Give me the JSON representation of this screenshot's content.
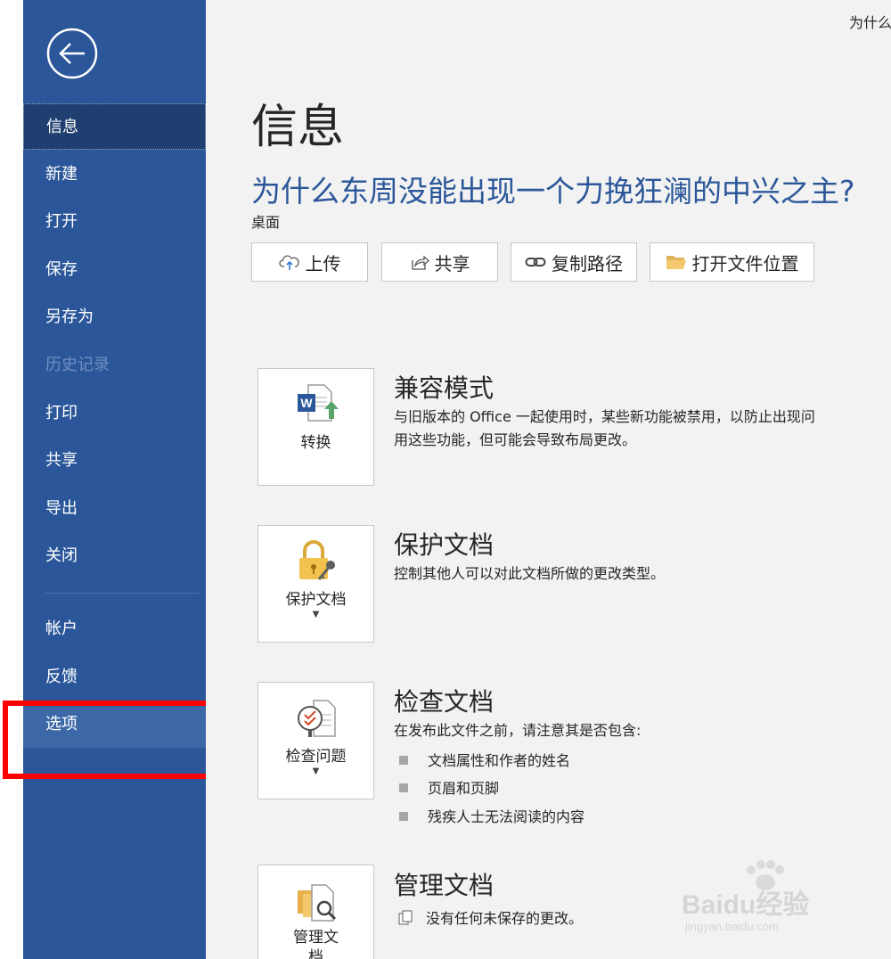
{
  "window": {
    "doc_short_title": "为什么"
  },
  "sidebar": {
    "items": [
      {
        "label": "信息"
      },
      {
        "label": "新建"
      },
      {
        "label": "打开"
      },
      {
        "label": "保存"
      },
      {
        "label": "另存为"
      },
      {
        "label": "历史记录"
      },
      {
        "label": "打印"
      },
      {
        "label": "共享"
      },
      {
        "label": "导出"
      },
      {
        "label": "关闭"
      }
    ],
    "bottom_items": [
      {
        "label": "帐户"
      },
      {
        "label": "反馈"
      },
      {
        "label": "选项"
      }
    ]
  },
  "main": {
    "page_title": "信息",
    "doc_title": "为什么东周没能出现一个力挽狂澜的中兴之主?",
    "doc_location": "桌面",
    "actions": [
      {
        "label": "上传",
        "icon": "cloud-upload-icon"
      },
      {
        "label": "共享",
        "icon": "share-icon"
      },
      {
        "label": "复制路径",
        "icon": "link-icon"
      },
      {
        "label": "打开文件位置",
        "icon": "folder-icon"
      }
    ],
    "sections": {
      "compat": {
        "button_label": "转换",
        "title": "兼容模式",
        "desc_line1": "与旧版本的 Office 一起使用时，某些新功能被禁用，以防止出现问",
        "desc_line2": "用这些功能，但可能会导致布局更改。"
      },
      "protect": {
        "button_label": "保护文档",
        "title": "保护文档",
        "desc": "控制其他人可以对此文档所做的更改类型。"
      },
      "inspect": {
        "button_label": "检查问题",
        "title": "检查文档",
        "desc": "在发布此文件之前，请注意其是否包含:",
        "bullets": [
          "文档属性和作者的姓名",
          "页眉和页脚",
          "残疾人士无法阅读的内容"
        ]
      },
      "manage": {
        "button_label_line1": "管理文",
        "button_label_line2": "档",
        "title": "管理文档",
        "desc": "没有任何未保存的更改。"
      }
    }
  },
  "watermark": {
    "text": "Baidu经验",
    "sub": "jingyan.baidu.com"
  },
  "colors": {
    "sidebar": "#2b579a",
    "accent": "#2b579a",
    "highlight": "#ff0000",
    "background": "#f2f2f2"
  }
}
